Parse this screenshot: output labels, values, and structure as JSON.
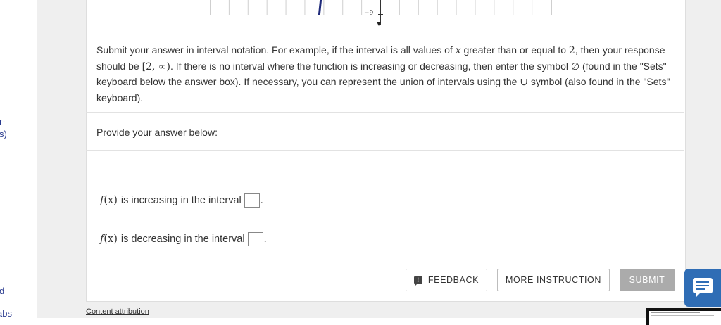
{
  "left_nav": {
    "fragments": [
      "r-",
      "s)",
      "d",
      "abs"
    ]
  },
  "graph": {
    "tick_label": "−9"
  },
  "instructions": {
    "part1": "Submit your answer in interval notation. For example, if the interval is all values of ",
    "var_x": "x",
    "part2": " greater than or equal to ",
    "num_2": "2",
    "part3": ", then your response should be ",
    "example_interval": "[2, ∞)",
    "part4": ". If there is no interval where the function is increasing or decreasing, then enter the symbol ",
    "empty_symbol": "∅",
    "part5": " (found in the \"Sets\" keyboard below the answer box). If necessary, you can represent the union of intervals using the ",
    "union_symbol": "∪",
    "part6": " symbol (also found in the \"Sets\" keyboard)."
  },
  "answer_section": {
    "prompt": "Provide your answer below:",
    "function_name": "f",
    "function_arg": "(x)",
    "increasing_text": "is increasing in the interval",
    "decreasing_text": "is decreasing in the interval",
    "period": "."
  },
  "buttons": {
    "feedback": "FEEDBACK",
    "feedback_icon_glyph": "!",
    "more_instruction": "MORE INSTRUCTION",
    "submit": "SUBMIT"
  },
  "footer": {
    "attribution": "Content attribution"
  },
  "colors": {
    "page_gray": "#efefef",
    "submit_disabled": "#ababab",
    "chat_blue": "#2f6db5",
    "curve": "#1f2a7a"
  },
  "icons": {
    "feedback": "feedback-exclamation-icon",
    "chat": "chat-bubble-icon"
  }
}
